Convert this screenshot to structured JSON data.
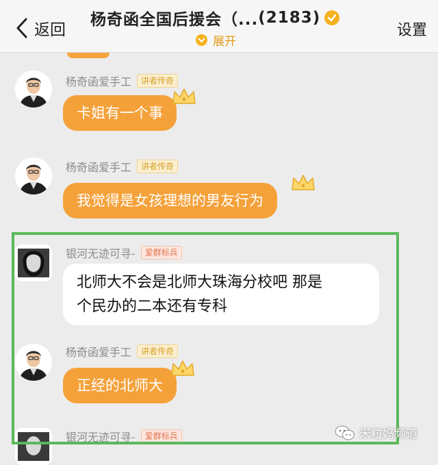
{
  "header": {
    "back_label": "返回",
    "title": "杨奇函全国后援会（...",
    "member_count": "(2183)",
    "expand_label": "展开",
    "settings_label": "设置",
    "accent_color": "#f5a13a",
    "badge_color": "#f5b21f"
  },
  "messages": [
    {
      "sender": "杨奇函爱手工",
      "tag": "讲者传奇",
      "text": "卡姐有一个事",
      "bubble": "orange"
    },
    {
      "sender": "杨奇函爱手工",
      "tag": "讲者传奇",
      "text": "我觉得是女孩理想的男友行为",
      "bubble": "orange"
    },
    {
      "sender": "银河无迹可寻-",
      "tag": "爱群标兵",
      "text_line1": "北师大不会是北师大珠海分校吧 那是",
      "text_line2": "个民办的二本还有专科",
      "bubble": "white"
    },
    {
      "sender": "杨奇函爱手工",
      "tag": "讲者传奇",
      "text": "正经的北师大",
      "bubble": "orange"
    },
    {
      "sender": "银河无迹可寻-",
      "tag": "爱群标兵"
    }
  ],
  "highlight_color": "#5cb85a",
  "watermark": {
    "text": "米粒妈频道"
  }
}
